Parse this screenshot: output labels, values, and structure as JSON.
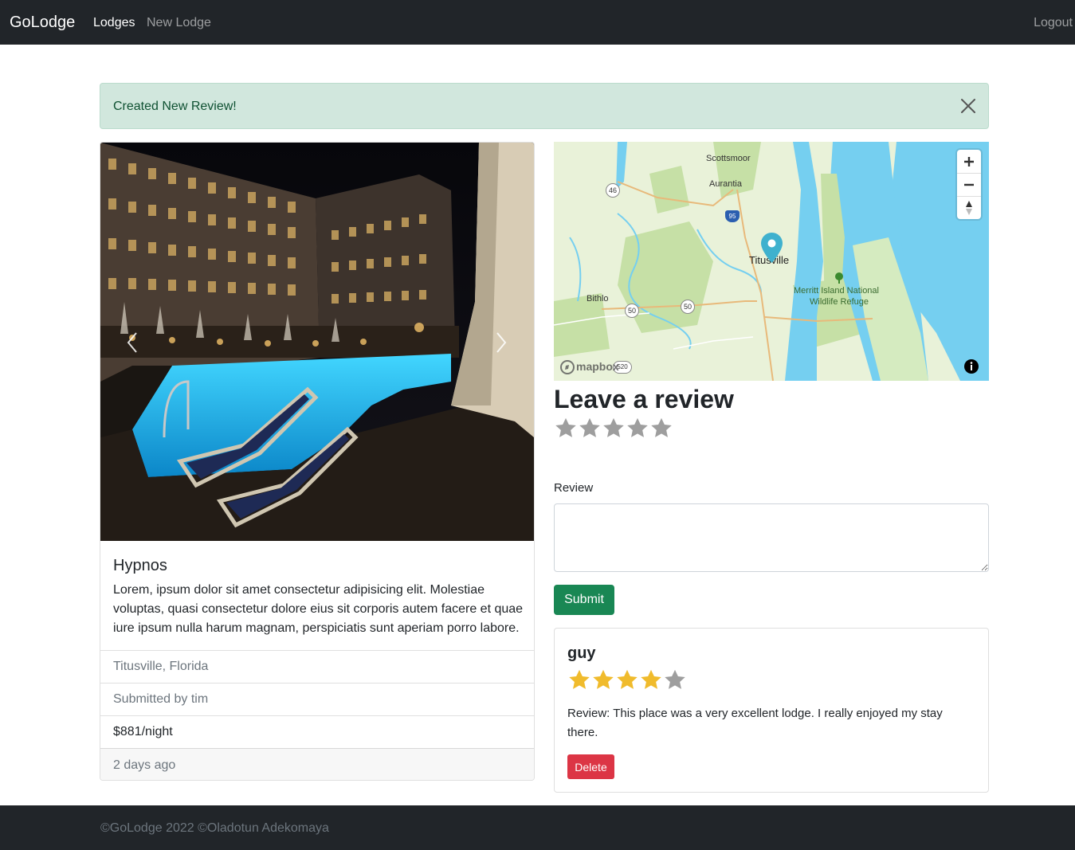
{
  "navbar": {
    "brand": "GoLodge",
    "links": {
      "lodges": "Lodges",
      "new_lodge": "New Lodge"
    },
    "logout": "Logout"
  },
  "alert": {
    "message": "Created New Review!",
    "close_icon": "close-icon"
  },
  "lodge": {
    "title": "Hypnos",
    "description": "Lorem, ipsum dolor sit amet consectetur adipisicing elit. Molestiae voluptas, quasi consectetur dolore eius sit corporis autem facere et quae iure ipsum nulla harum magnam, perspiciatis sunt aperiam porro labore.",
    "location": "Titusville, Florida",
    "submitted_by": "Submitted by tim",
    "price": "$881/night",
    "posted": "2 days ago",
    "image_description": "Hotel pool at night with lounge chairs"
  },
  "map": {
    "labels": {
      "scottsmoor": "Scottsmoor",
      "aurantia": "Aurantia",
      "titusville": "Titusville",
      "bithlo": "Bithlo",
      "merritt1": "Merritt Island National",
      "merritt2": "Wildlife Refuge",
      "r46": "46",
      "r95": "95",
      "r50a": "50",
      "r50b": "50",
      "r520": "520",
      "logo": "mapbox"
    },
    "controls": {
      "zoom_in": "+",
      "zoom_out": "−"
    },
    "colors": {
      "water": "#75cff0",
      "land": "#e9f2d9",
      "park": "#c6e0a6",
      "road": "#e8b97a",
      "marker": "#3fb1ce"
    }
  },
  "review_form": {
    "heading": "Leave a review",
    "rating_stars": 5,
    "rating_value": 0,
    "label": "Review",
    "textarea_value": "",
    "submit_label": "Submit"
  },
  "reviews": [
    {
      "author": "guy",
      "rating": 4,
      "rating_max": 5,
      "text": "Review: This place was a very excellent lodge. I really enjoyed my stay there.",
      "delete_label": "Delete"
    }
  ],
  "footer": {
    "text": "©GoLodge 2022 ©Oladotun Adekomaya"
  },
  "colors": {
    "success": "#198754",
    "danger": "#dc3545",
    "star_filled": "#f0bb2c",
    "star_empty": "#9e9e9e",
    "dark": "#212529"
  }
}
